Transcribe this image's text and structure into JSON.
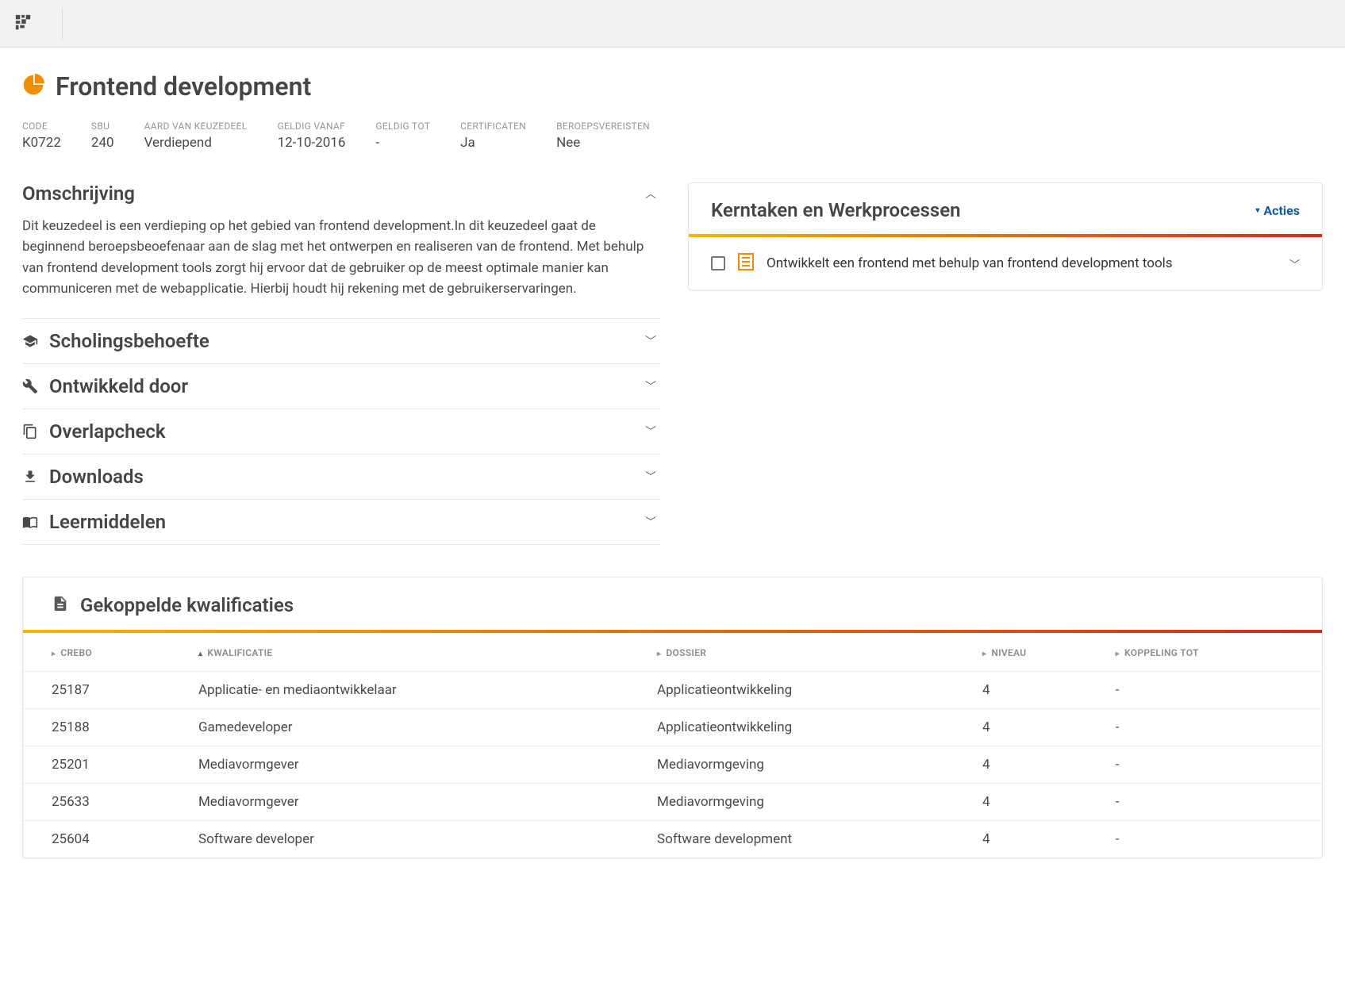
{
  "page": {
    "title": "Frontend development"
  },
  "meta": {
    "code": {
      "label": "CODE",
      "value": "K0722"
    },
    "sbu": {
      "label": "SBU",
      "value": "240"
    },
    "aard": {
      "label": "AARD VAN KEUZEDEEL",
      "value": "Verdiepend"
    },
    "geldig_vanaf": {
      "label": "GELDIG VANAF",
      "value": "12-10-2016"
    },
    "geldig_tot": {
      "label": "GELDIG TOT",
      "value": "-"
    },
    "certificaten": {
      "label": "CERTIFICATEN",
      "value": "Ja"
    },
    "beroepsvereisten": {
      "label": "BEROEPSVEREISTEN",
      "value": "Nee"
    }
  },
  "accordion": {
    "omschrijving": {
      "title": "Omschrijving",
      "body": "Dit keuzedeel is een verdieping op het gebied van frontend development.In dit keuzedeel gaat de beginnend beroepsbeoefenaar aan de slag met het ontwerpen en realiseren van de frontend. Met behulp van frontend development tools zorgt hij ervoor dat de gebruiker op de meest optimale manier kan communiceren met de webapplicatie. Hierbij houdt hij rekening met de gebruikerservaringen."
    },
    "scholingsbehoefte": {
      "title": "Scholingsbehoefte"
    },
    "ontwikkeld_door": {
      "title": "Ontwikkeld door"
    },
    "overlapcheck": {
      "title": "Overlapcheck"
    },
    "downloads": {
      "title": "Downloads"
    },
    "leermiddelen": {
      "title": "Leermiddelen"
    }
  },
  "tasks_panel": {
    "title": "Kerntaken en Werkprocessen",
    "acties_label": "Acties",
    "items": [
      {
        "text": "Ontwikkelt een frontend met behulp van frontend development tools"
      }
    ]
  },
  "kwalificaties": {
    "title": "Gekoppelde kwalificaties",
    "columns": {
      "crebo": "CREBO",
      "kwalificatie": "KWALIFICATIE",
      "dossier": "DOSSIER",
      "niveau": "NIVEAU",
      "koppeling_tot": "KOPPELING TOT"
    },
    "rows": [
      {
        "crebo": "25187",
        "kwalificatie": "Applicatie- en mediaontwikkelaar",
        "dossier": "Applicatieontwikkeling",
        "niveau": "4",
        "koppeling_tot": "-"
      },
      {
        "crebo": "25188",
        "kwalificatie": "Gamedeveloper",
        "dossier": "Applicatieontwikkeling",
        "niveau": "4",
        "koppeling_tot": "-"
      },
      {
        "crebo": "25201",
        "kwalificatie": "Mediavormgever",
        "dossier": "Mediavormgeving",
        "niveau": "4",
        "koppeling_tot": "-"
      },
      {
        "crebo": "25633",
        "kwalificatie": "Mediavormgever",
        "dossier": "Mediavormgeving",
        "niveau": "4",
        "koppeling_tot": "-"
      },
      {
        "crebo": "25604",
        "kwalificatie": "Software developer",
        "dossier": "Software development",
        "niveau": "4",
        "koppeling_tot": "-"
      }
    ]
  }
}
